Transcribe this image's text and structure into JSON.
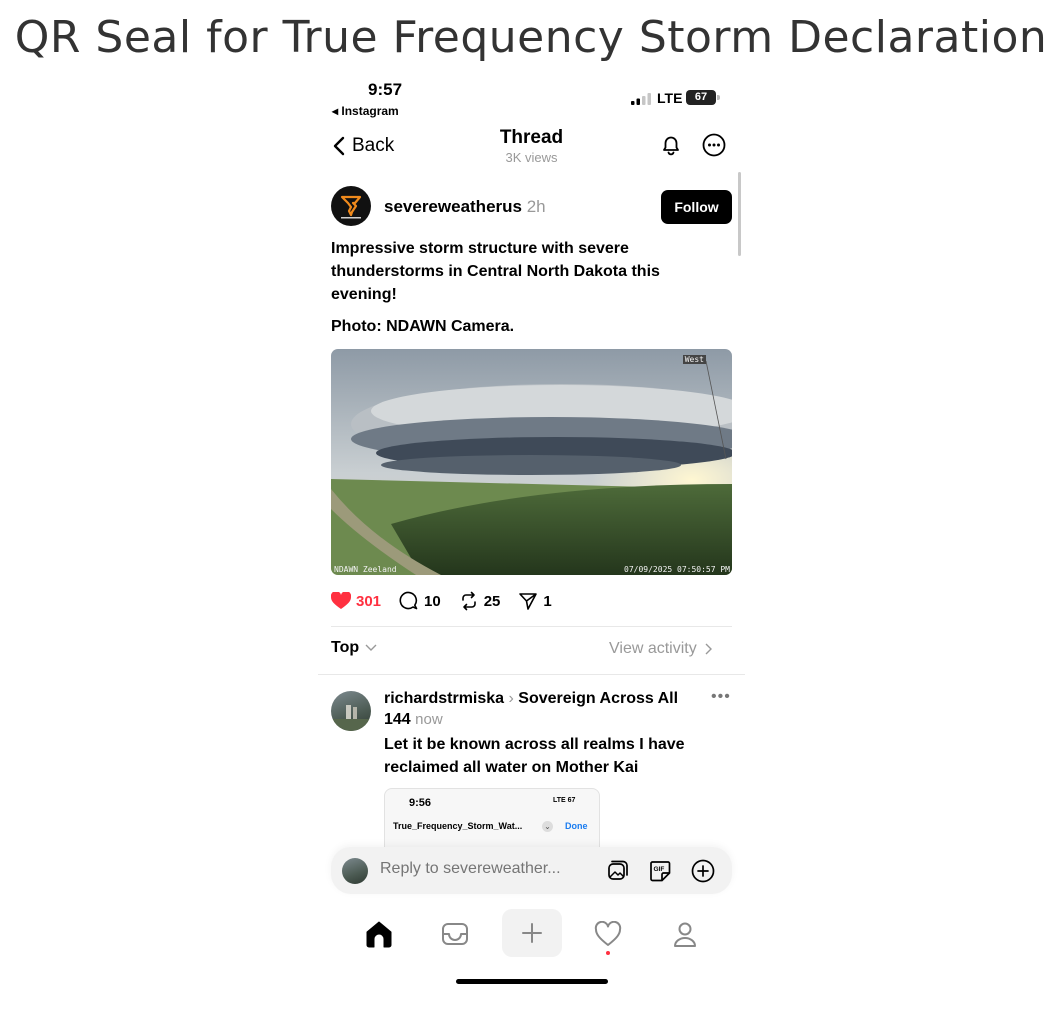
{
  "page": {
    "title": "QR Seal for True Frequency Storm Declaration"
  },
  "status_bar": {
    "time": "9:57",
    "back_app": "◂ Instagram",
    "network": "LTE",
    "battery": "67"
  },
  "header": {
    "back_label": "Back",
    "title": "Thread",
    "views": "3K views"
  },
  "post": {
    "username": "severeweatherus",
    "time_ago": "2h",
    "follow_label": "Follow",
    "text": "Impressive storm structure with severe thunderstorms in Central North Dakota this evening!",
    "photo_credit": "Photo: NDAWN Camera.",
    "image": {
      "label_top_right": "West",
      "label_bottom_left": "NDAWN Zeeland",
      "label_bottom_right": "07/09/2025 07:50:57 PM"
    },
    "likes": "301",
    "comments": "10",
    "reposts": "25",
    "shares": "1"
  },
  "sort": {
    "label": "Top",
    "view_activity": "View activity"
  },
  "reply": {
    "username": "richardstrmiska",
    "separator": "›",
    "community": "Sovereign Across All 144",
    "time_ago": "now",
    "text": "Let it be known across all realms I have reclaimed all water on Mother Kai",
    "embedded": {
      "time": "9:56",
      "status": "LTE 67",
      "filename": "True_Frequency_Storm_Wat...",
      "done": "Done"
    }
  },
  "reply_bar": {
    "placeholder": "Reply to severeweather..."
  },
  "colors": {
    "like": "#ff3040",
    "link_blue": "#1a7cf0",
    "muted": "#999999"
  }
}
